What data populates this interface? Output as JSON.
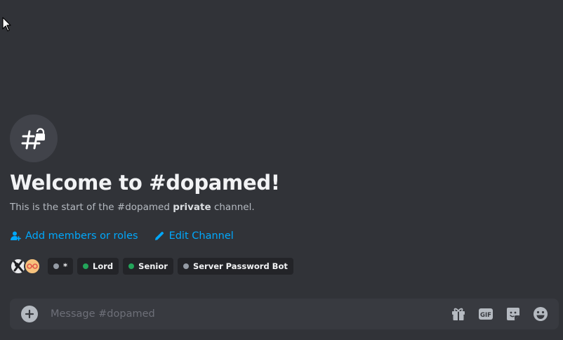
{
  "welcome": {
    "title": "Welcome to #dopamed!",
    "subtitle_prefix": "This is the start of the #dopamed ",
    "subtitle_bold": "private",
    "subtitle_suffix": " channel."
  },
  "actions": {
    "add_members": "Add members or roles",
    "edit_channel": "Edit Channel"
  },
  "roles": [
    {
      "name": "*",
      "color": "#949ba4"
    },
    {
      "name": "Lord",
      "color": "#23a55a"
    },
    {
      "name": "Senior",
      "color": "#23a55a"
    },
    {
      "name": "Server Password Bot",
      "color": "#949ba4"
    }
  ],
  "composer": {
    "placeholder": "Message #dopamed",
    "gif_label": "GIF"
  },
  "colors": {
    "background": "#313338",
    "link": "#00a8fc",
    "composer_bg": "#383a40"
  },
  "icons": {
    "channel": "locked-hashtag-icon",
    "add_members": "add-member-icon",
    "edit": "pencil-icon",
    "attach": "plus-circle-icon",
    "gift": "gift-icon",
    "gif": "gif-icon",
    "sticker": "sticker-icon",
    "emoji": "emoji-icon"
  }
}
